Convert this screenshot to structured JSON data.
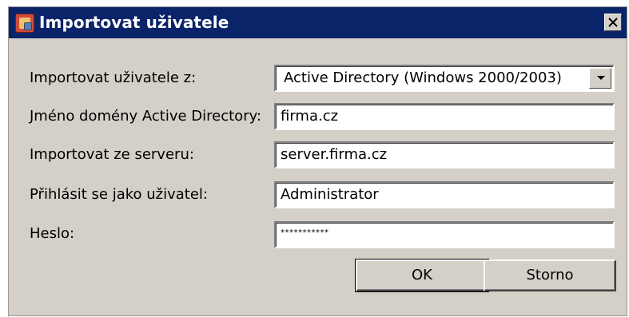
{
  "dialog": {
    "title": "Importovat uživatele",
    "close_label": "×"
  },
  "form": {
    "import_from_label": "Importovat uživatele z:",
    "import_from_value": "Active Directory (Windows 2000/2003)",
    "domain_label": "Jméno domény Active Directory:",
    "domain_value": "firma.cz",
    "server_label": "Importovat ze serveru:",
    "server_value": "server.firma.cz",
    "login_label": "Přihlásit se jako uživatel:",
    "login_value": "Administrator",
    "password_label": "Heslo:",
    "password_value": "***********"
  },
  "buttons": {
    "ok_label": "OK",
    "cancel_label": "Storno"
  },
  "colors": {
    "titlebar": "#0a246a",
    "dialog_bg": "#d4d0c8",
    "field_bg": "#ffffff"
  },
  "icons": {
    "app": "import-users-icon",
    "close": "close-icon",
    "dropdown": "chevron-down-icon"
  }
}
